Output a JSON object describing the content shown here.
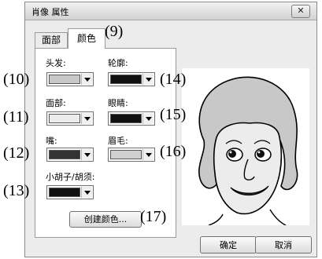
{
  "dialog": {
    "title": "肖像 属性",
    "close_icon": "✕",
    "tabs": [
      "面部",
      "颜色"
    ],
    "fields": {
      "hair_label": "头发:",
      "outline_label": "轮廓:",
      "face_label": "面部:",
      "eyes_label": "眼睛:",
      "mouth_label": "嘴:",
      "eyebrow_label": "眉毛:",
      "beard_label": "小胡子/胡须:"
    },
    "swatches": {
      "hair": "#c8c8c8",
      "outline": "#111111",
      "face": "#ececec",
      "eyes": "#111111",
      "mouth": "#333333",
      "eyebrow": "#cfcfcf",
      "beard": "#111111"
    },
    "create_color_button": "创建颜色...",
    "ok_button": "确定",
    "cancel_button": "取消"
  },
  "callouts": [
    "(9)",
    "(10)",
    "(11)",
    "(12)",
    "(13)",
    "(14)",
    "(15)",
    "(16)",
    "(17)"
  ],
  "preview": {
    "icon": "portrait-face-icon"
  }
}
